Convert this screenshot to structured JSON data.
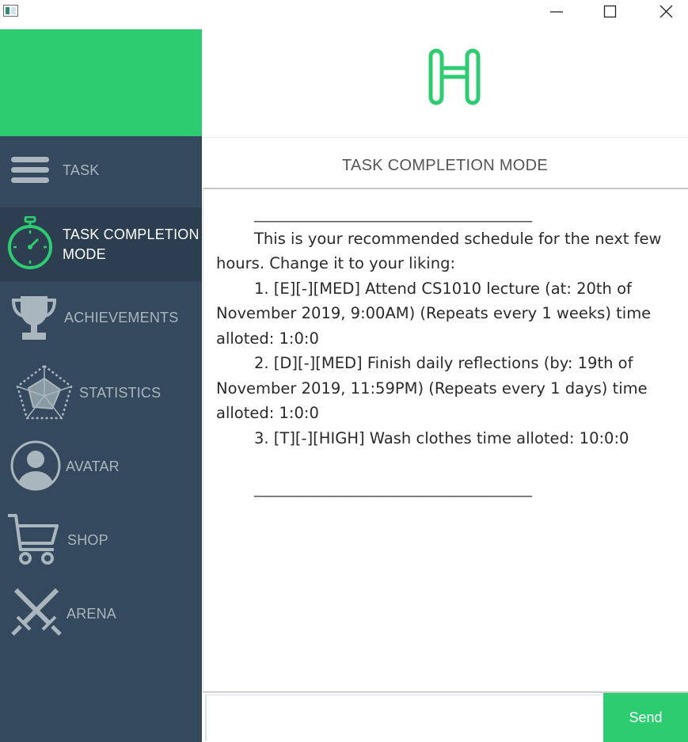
{
  "window": {
    "icons": [
      "app-icon",
      "minimize-icon",
      "maximize-icon",
      "close-icon"
    ]
  },
  "colors": {
    "accent": "#2ecc71",
    "sidebar": "#34495e",
    "sidebar_active": "#2c3e50",
    "sidebar_text": "#a9b6bd"
  },
  "sidebar": {
    "items": [
      {
        "label": "TASK",
        "icon": "menu-icon",
        "active": false
      },
      {
        "label": "TASK COMPLETION",
        "label_line2": "MODE",
        "icon": "stopwatch-icon",
        "active": true
      },
      {
        "label": "ACHIEVEMENTS",
        "icon": "trophy-icon",
        "active": false
      },
      {
        "label": "STATISTICS",
        "icon": "radar-chart-icon",
        "active": false
      },
      {
        "label": "AVATAR",
        "icon": "avatar-icon",
        "active": false
      },
      {
        "label": "SHOP",
        "icon": "cart-icon",
        "active": false
      },
      {
        "label": "ARENA",
        "icon": "crossed-swords-icon",
        "active": false
      }
    ]
  },
  "header": {
    "logo_icon": "h-logo-icon",
    "mode_title": "TASK COMPLETION MODE"
  },
  "chat": {
    "separator": "____________________________________",
    "intro": "This is your recommended schedule for the next few hours. Change it to your liking:",
    "items": [
      "1. [E][-][MED] Attend CS1010 lecture (at: 20th of November 2019, 9:00AM) (Repeats every 1 weeks) time alloted: 1:0:0",
      "2. [D][-][MED] Finish daily reflections (by: 19th of November 2019, 11:59PM) (Repeats every 1 days) time alloted: 1:0:0",
      "3. [T][-][HIGH] Wash clothes time alloted: 10:0:0"
    ]
  },
  "input": {
    "value": "",
    "placeholder": "",
    "send_label": "Send"
  }
}
